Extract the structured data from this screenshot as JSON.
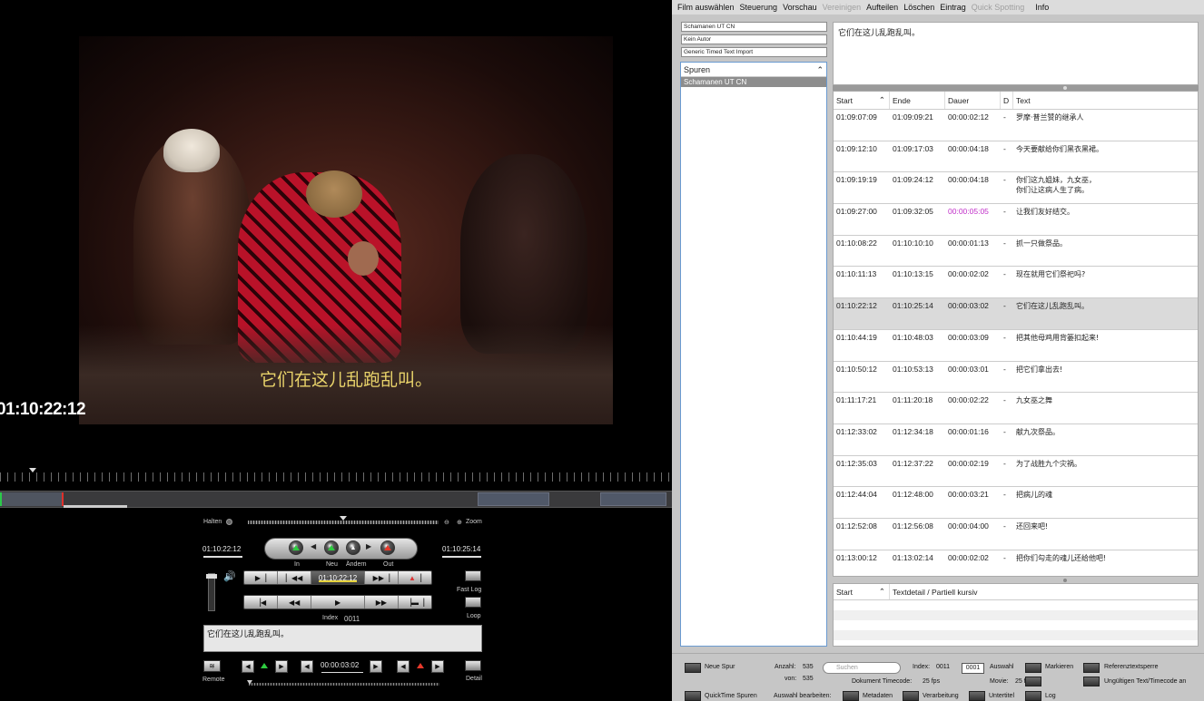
{
  "video": {
    "subtitle": "它们在这儿乱跑乱叫。",
    "timecode": "01:10:22:12"
  },
  "controls": {
    "halten_label": "Halten",
    "zoom_label": "Zoom",
    "in_timecode": "01:10:22:12",
    "out_timecode": "01:10:25:14",
    "btn_in": "In",
    "btn_neu": "Neu",
    "btn_aendern": "Ändern",
    "btn_out": "Out",
    "current_timecode": "01:10:22:12",
    "index_label": "Index",
    "index_value": "0011",
    "fast_log": "Fast Log",
    "loop": "Loop",
    "note_text": "它们在这儿乱跑乱叫。",
    "remote": "Remote",
    "duration": "00:00:03:02",
    "detail": "Detail"
  },
  "menu": {
    "items": [
      {
        "label": "Film auswählen",
        "enabled": true
      },
      {
        "label": "Steuerung",
        "enabled": true
      },
      {
        "label": "Vorschau",
        "enabled": true
      },
      {
        "label": "Vereinigen",
        "enabled": false
      },
      {
        "label": "Aufteilen",
        "enabled": true
      },
      {
        "label": "Löschen",
        "enabled": true
      },
      {
        "label": "Eintrag",
        "enabled": true
      },
      {
        "label": "Quick Spotting",
        "enabled": false
      },
      {
        "label": "Info",
        "enabled": true
      }
    ]
  },
  "project": {
    "fields": [
      "Schamanen UT CN",
      "Kein Autor",
      "Generic Timed Text Import"
    ],
    "spuren_label": "Spuren",
    "selected_track": "Schamanen UT CN"
  },
  "preview_text": "它们在这儿乱跑乱叫。",
  "table": {
    "headers": {
      "start": "Start",
      "ende": "Ende",
      "dauer": "Dauer",
      "d": "D",
      "text": "Text"
    },
    "rows": [
      {
        "start": "01:09:07:09",
        "ende": "01:09:09:21",
        "dauer": "00:00:02:12",
        "d": "-",
        "text": "罗摩·普兰赞的继承人"
      },
      {
        "start": "01:09:12:10",
        "ende": "01:09:17:03",
        "dauer": "00:00:04:18",
        "d": "-",
        "text": "今天要献给你们黑衣黑裙。"
      },
      {
        "start": "01:09:19:19",
        "ende": "01:09:24:12",
        "dauer": "00:00:04:18",
        "d": "-",
        "text": "你们这九姐妹，九女巫，\n你们让这病人生了病。"
      },
      {
        "start": "01:09:27:00",
        "ende": "01:09:32:05",
        "dauer": "00:00:05:05",
        "d": "-",
        "text": "让我们友好结交。",
        "highlight": true
      },
      {
        "start": "01:10:08:22",
        "ende": "01:10:10:10",
        "dauer": "00:00:01:13",
        "d": "-",
        "text": "抓一只做祭品。"
      },
      {
        "start": "01:10:11:13",
        "ende": "01:10:13:15",
        "dauer": "00:00:02:02",
        "d": "-",
        "text": "现在就用它们祭祀吗?"
      },
      {
        "start": "01:10:22:12",
        "ende": "01:10:25:14",
        "dauer": "00:00:03:02",
        "d": "-",
        "text": "它们在这儿乱跑乱叫。",
        "selected": true
      },
      {
        "start": "01:10:44:19",
        "ende": "01:10:48:03",
        "dauer": "00:00:03:09",
        "d": "-",
        "text": "把其他母鸡用背篓扣起来!"
      },
      {
        "start": "01:10:50:12",
        "ende": "01:10:53:13",
        "dauer": "00:00:03:01",
        "d": "-",
        "text": "把它们拿出去!"
      },
      {
        "start": "01:11:17:21",
        "ende": "01:11:20:18",
        "dauer": "00:00:02:22",
        "d": "-",
        "text": "九女巫之舞"
      },
      {
        "start": "01:12:33:02",
        "ende": "01:12:34:18",
        "dauer": "00:00:01:16",
        "d": "-",
        "text": "献九次祭品。"
      },
      {
        "start": "01:12:35:03",
        "ende": "01:12:37:22",
        "dauer": "00:00:02:19",
        "d": "-",
        "text": "为了战胜九个灾祸。"
      },
      {
        "start": "01:12:44:04",
        "ende": "01:12:48:00",
        "dauer": "00:00:03:21",
        "d": "-",
        "text": "把病儿的魂"
      },
      {
        "start": "01:12:52:08",
        "ende": "01:12:56:08",
        "dauer": "00:00:04:00",
        "d": "-",
        "text": "还回来吧!"
      },
      {
        "start": "01:13:00:12",
        "ende": "01:13:02:14",
        "dauer": "00:00:02:02",
        "d": "-",
        "text": "把你们勾走的魂儿还给他吧!"
      }
    ]
  },
  "detail": {
    "start_header": "Start",
    "text_header": "Textdetail / Partiell kursiv"
  },
  "bottom": {
    "neue_spur": "Neue Spur",
    "quicktime_spuren": "QuickTime Spuren",
    "anzahl_label": "Anzahl:",
    "anzahl_value": "535",
    "von_label": "von:",
    "von_value": "535",
    "search_placeholder": "Suchen",
    "index_label": "Index:",
    "index_value": "0011",
    "index_box": "0001",
    "auswahl": "Auswahl",
    "dokument_timecode_label": "Dokument Timecode:",
    "dokument_timecode_value": "25 fps",
    "movie_label": "Movie:",
    "movie_value": "25 fps",
    "markieren": "Markieren",
    "referenztextsperre": "Referenztextsperre",
    "ungueltig": "Ungültigen Text/Timecode an",
    "auswahl_bearbeiten": "Auswahl bearbeiten:",
    "metadaten": "Metadaten",
    "verarbeitung": "Verarbeitung",
    "untertitel": "Untertitel",
    "log": "Log"
  },
  "colors": {
    "highlight_duration": "#c02ec8",
    "subtitle": "#e9d36a",
    "selected_row": "#dadada"
  }
}
